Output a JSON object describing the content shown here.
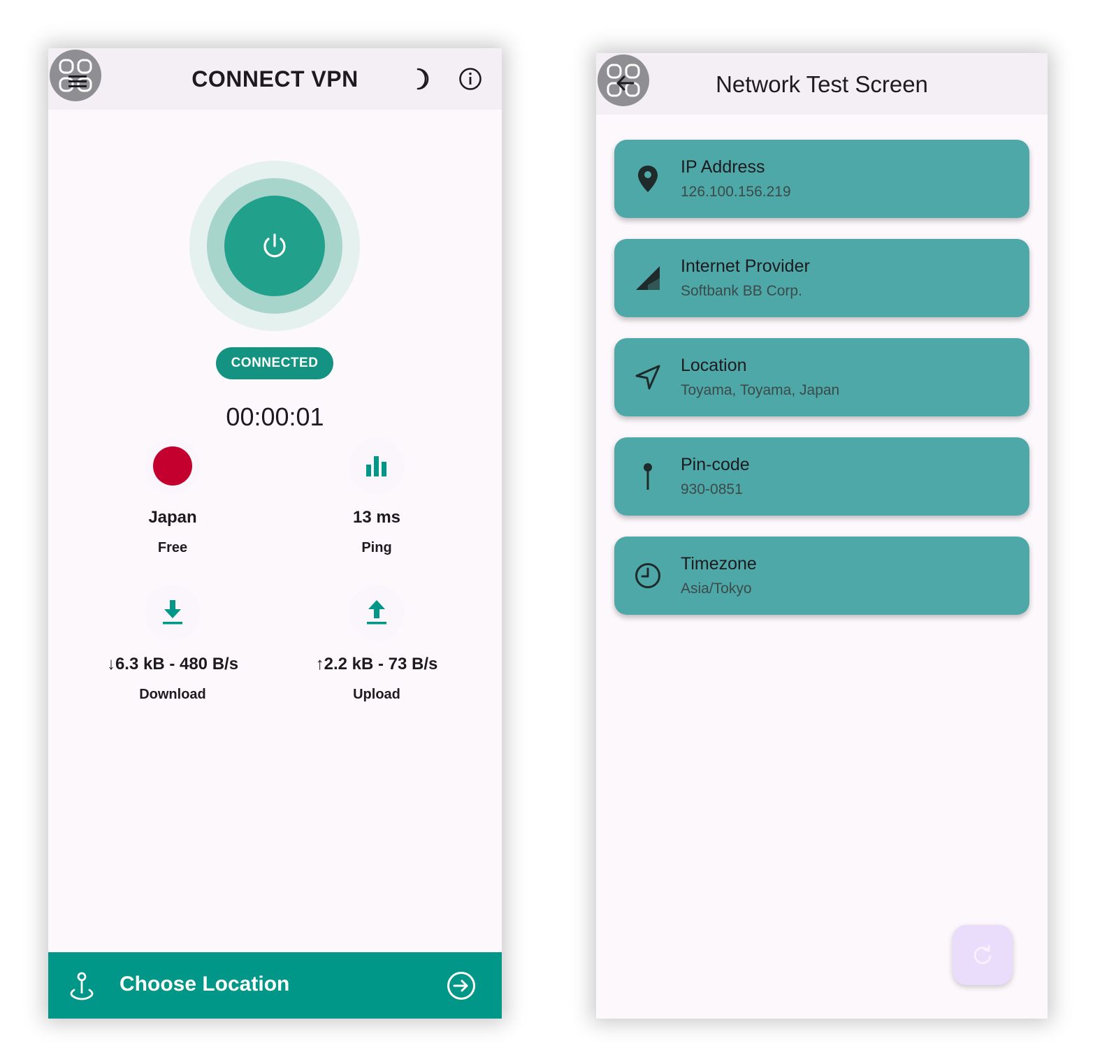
{
  "vpn_screen": {
    "title": "CONNECT VPN",
    "status": "CONNECTED",
    "timer": "00:00:01",
    "server": {
      "country": "Japan",
      "tier": "Free"
    },
    "ping": {
      "value": "13 ms",
      "label": "Ping"
    },
    "download": {
      "value": "↓6.3 kB - 480 B/s",
      "label": "Download"
    },
    "upload": {
      "value": "↑2.2 kB - 73 B/s",
      "label": "Upload"
    },
    "choose_location": "Choose Location",
    "icons": [
      "app-logo-icon",
      "menu-icon",
      "moon-icon",
      "info-icon",
      "power-icon",
      "japan-flag-icon",
      "bar-chart-icon",
      "download-icon",
      "upload-icon",
      "location-pin-icon",
      "arrow-right-circle-icon"
    ],
    "colors": {
      "accent": "#009688",
      "flag_red": "#c4002f"
    }
  },
  "network_screen": {
    "title": "Network Test Screen",
    "cards": [
      {
        "title": "IP Address",
        "value": "126.100.156.219",
        "icon": "location-pin-icon"
      },
      {
        "title": "Internet Provider",
        "value": "Softbank BB Corp.",
        "icon": "signal-icon"
      },
      {
        "title": "Location",
        "value": "Toyama, Toyama, Japan",
        "icon": "navigation-icon"
      },
      {
        "title": "Pin-code",
        "value": "930-0851",
        "icon": "pushpin-icon"
      },
      {
        "title": "Timezone",
        "value": "Asia/Tokyo",
        "icon": "clock-icon"
      }
    ],
    "colors": {
      "card": "#4fa8a8",
      "fab": "#eadcfb"
    }
  }
}
